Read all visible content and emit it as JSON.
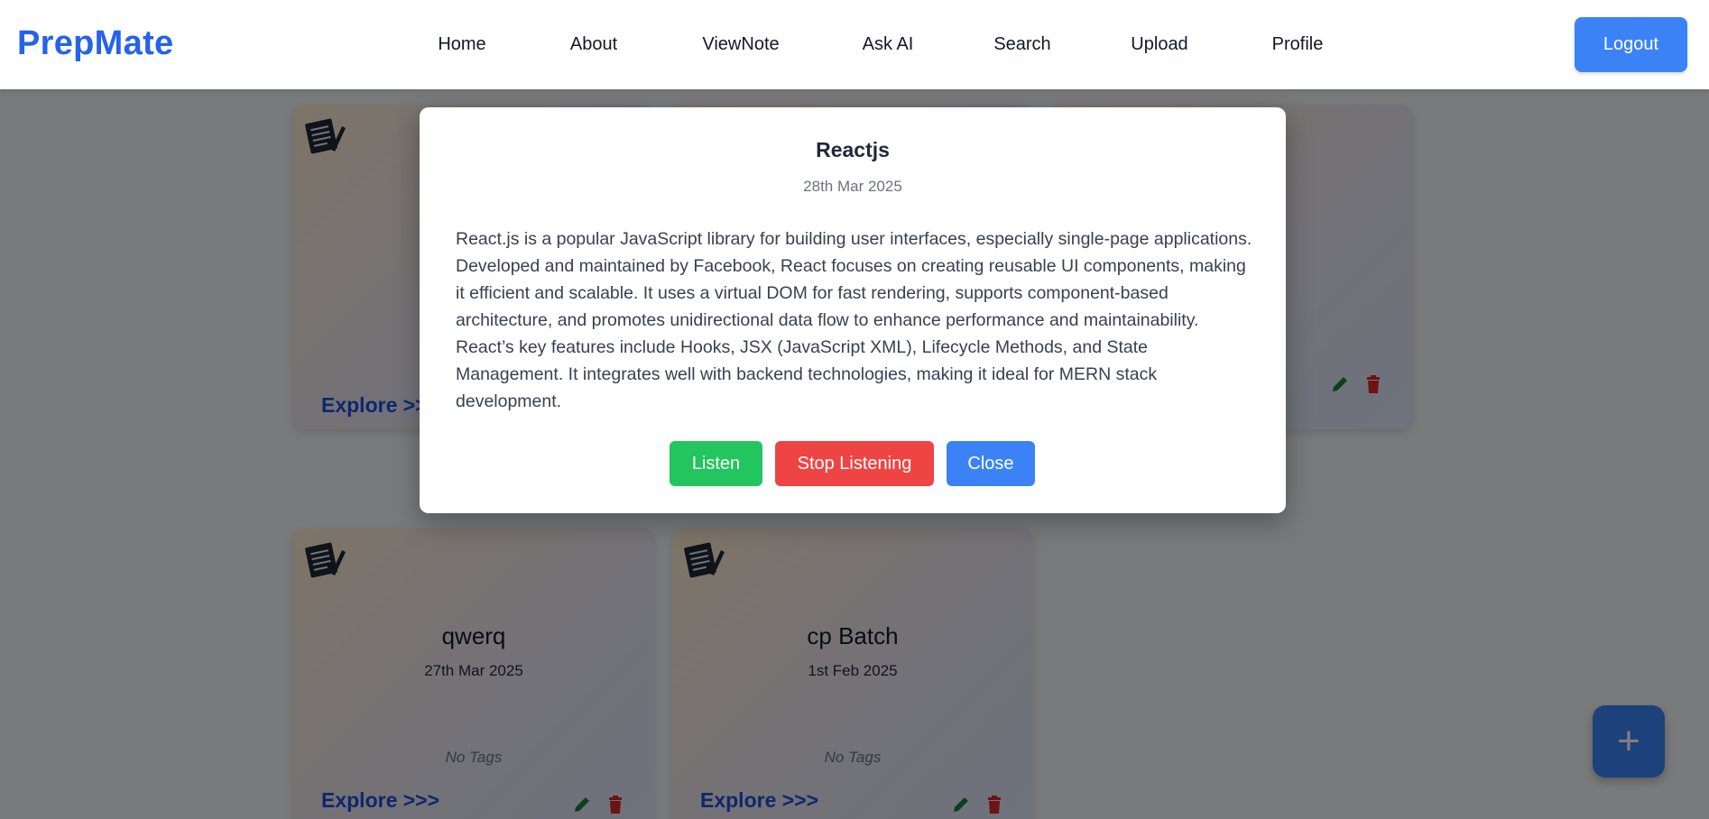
{
  "brand": "PrepMate",
  "nav": {
    "items": [
      "Home",
      "About",
      "ViewNote",
      "Ask AI",
      "Search",
      "Upload",
      "Profile"
    ],
    "logout_label": "Logout"
  },
  "cards": [
    {
      "title": "",
      "date": "",
      "tags": "",
      "explore": "Explore >>>"
    },
    {
      "title": "qwerq",
      "date": "27th Mar 2025",
      "tags": "No Tags",
      "explore": "Explore >>>"
    },
    {
      "title": "cp Batch",
      "date": "1st Feb 2025",
      "tags": "No Tags",
      "explore": "Explore >>>"
    }
  ],
  "fab_label": "+",
  "modal": {
    "title": "Reactjs",
    "date": "28th Mar 2025",
    "body": "React.js is a popular JavaScript library for building user interfaces, especially single-page applications. Developed and maintained by Facebook, React focuses on creating reusable UI components, making it efficient and scalable. It uses a virtual DOM for fast rendering, supports component-based architecture, and promotes unidirectional data flow to enhance performance and maintainability. React’s key features include Hooks, JSX (JavaScript XML), Lifecycle Methods, and State Management. It integrates well with backend technologies, making it ideal for MERN stack development.",
    "listen_label": "Listen",
    "stop_label": "Stop Listening",
    "close_label": "Close"
  },
  "colors": {
    "brand": "#2563eb",
    "primary": "#3b82f6",
    "listen": "#22c55e",
    "stop": "#ef4444",
    "edit": "#15803d",
    "delete": "#dc2626"
  },
  "icons": {
    "card": "notepad-icon",
    "edit": "pencil-icon",
    "delete": "trash-icon",
    "fab": "plus-icon"
  }
}
